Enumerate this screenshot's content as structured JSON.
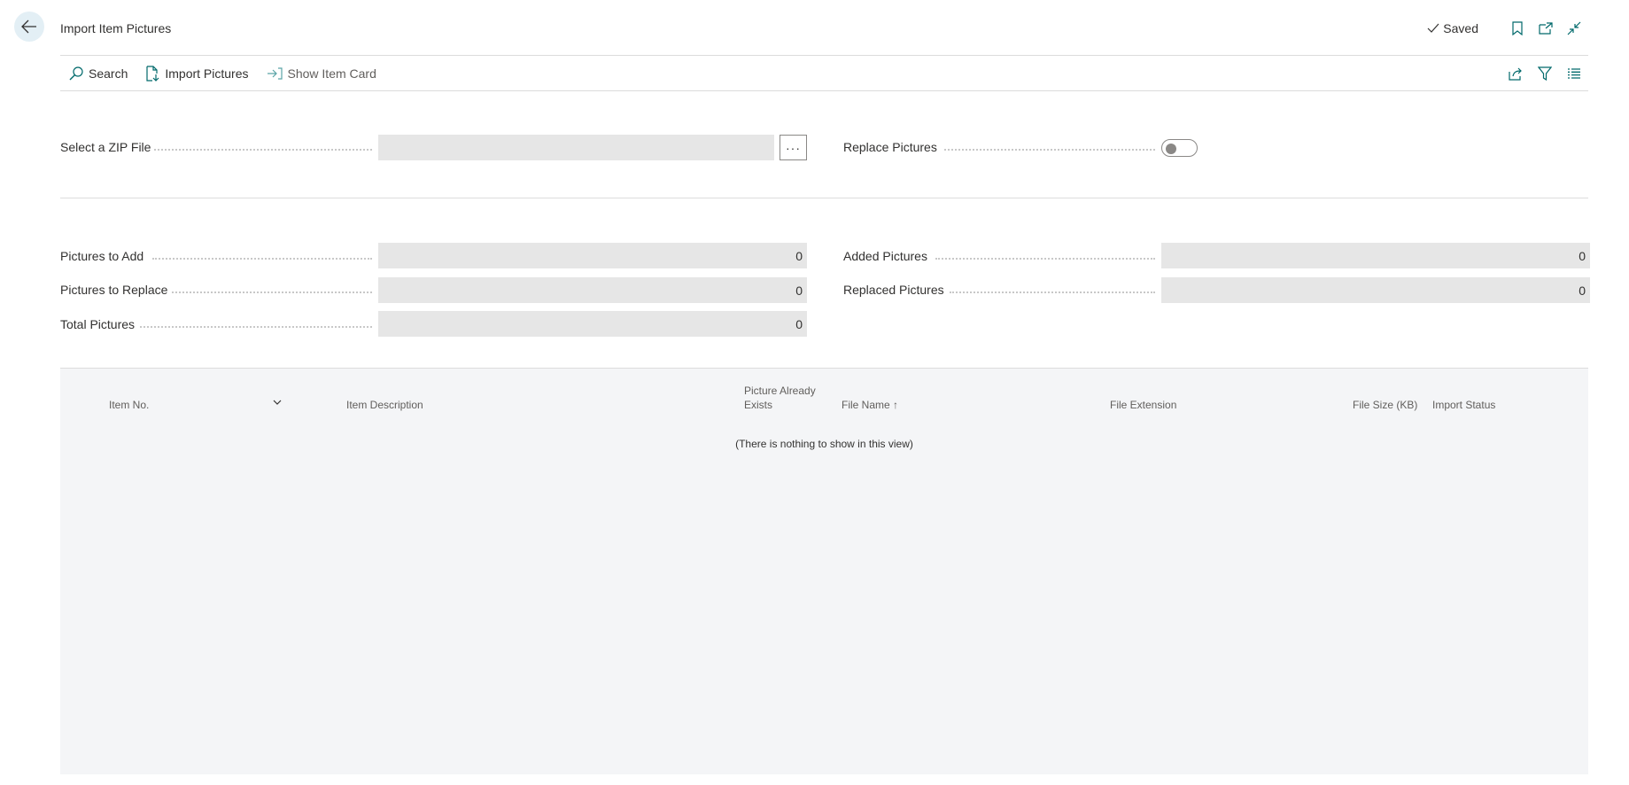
{
  "header": {
    "title": "Import Item Pictures",
    "saved_label": "Saved"
  },
  "actions": [
    {
      "label": "Search",
      "icon": "search-icon"
    },
    {
      "label": "Import Pictures",
      "icon": "import-pictures-icon"
    },
    {
      "label": "Show Item Card",
      "icon": "show-item-card-icon"
    }
  ],
  "fields": {
    "zip_file": {
      "label": "Select a ZIP File",
      "value": "",
      "assist_label": "···"
    },
    "replace_pictures": {
      "label": "Replace Pictures",
      "value": false
    },
    "pictures_to_add": {
      "label": "Pictures to Add",
      "value": "0"
    },
    "pictures_to_replace": {
      "label": "Pictures to Replace",
      "value": "0"
    },
    "total_pictures": {
      "label": "Total Pictures",
      "value": "0"
    },
    "added_pictures": {
      "label": "Added Pictures",
      "value": "0"
    },
    "replaced_pictures": {
      "label": "Replaced Pictures",
      "value": "0"
    }
  },
  "grid": {
    "columns": {
      "item_no": "Item No.",
      "item_description": "Item Description",
      "picture_exists_line1": "Picture Already",
      "picture_exists_line2": "Exists",
      "file_name": "File Name",
      "file_name_sort": "↑",
      "file_extension": "File Extension",
      "file_size": "File Size (KB)",
      "import_status": "Import Status"
    },
    "empty_message": "(There is nothing to show in this view)"
  },
  "colors": {
    "accent": "#00696b",
    "field_bg": "#e6e6e6",
    "grid_bg": "#f4f5f7",
    "back_button_bg": "#e3eff5"
  }
}
